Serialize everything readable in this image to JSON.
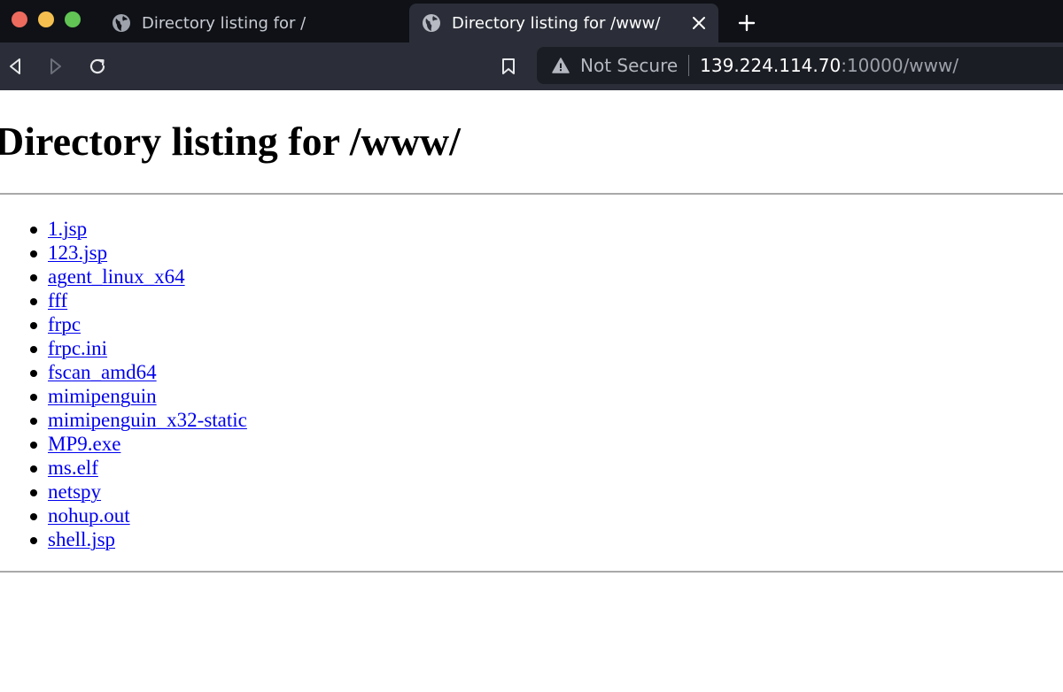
{
  "window": {
    "traffic_lights": [
      "close",
      "minimize",
      "maximize"
    ]
  },
  "tabs": [
    {
      "title": "Directory listing for /",
      "icon": "globe-icon",
      "active": false
    },
    {
      "title": "Directory listing for /www/",
      "icon": "globe-icon",
      "active": true,
      "close_icon": "close-icon"
    }
  ],
  "new_tab_icon": "plus-icon",
  "toolbar": {
    "back_icon": "back-icon",
    "forward_icon": "forward-icon",
    "reload_icon": "reload-icon",
    "bookmark_icon": "bookmark-icon"
  },
  "address_bar": {
    "security_icon": "warning-icon",
    "security_text": "Not Secure",
    "host": "139.224.114.70",
    "rest": ":10000/www/"
  },
  "page": {
    "heading": "Directory listing for /www/",
    "files": [
      "1.jsp",
      "123.jsp",
      "agent_linux_x64",
      "fff",
      "frpc",
      "frpc.ini",
      "fscan_amd64",
      "mimipenguin",
      "mimipenguin_x32-static",
      "MP9.exe",
      "ms.elf",
      "netspy",
      "nohup.out",
      "shell.jsp"
    ]
  },
  "colors": {
    "tabstrip_bg": "#0f1117",
    "toolbar_bg": "#2b2e38",
    "urlbar_bg": "#1b1d24",
    "link": "#0000ee",
    "traffic_red": "#ed6a5e",
    "traffic_yellow": "#f5bf4f",
    "traffic_green": "#61c454"
  }
}
